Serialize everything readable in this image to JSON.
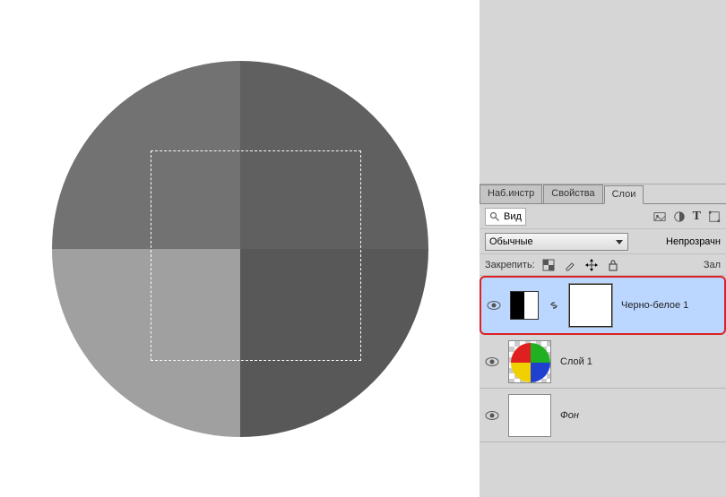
{
  "tabs": {
    "presets": "Наб.инстр",
    "properties": "Свойства",
    "layers": "Слои"
  },
  "search": {
    "label": "Вид"
  },
  "blend": {
    "mode": "Обычные",
    "opacity_label": "Непрозрачн"
  },
  "lock": {
    "label": "Закрепить:",
    "fill_label": "Зал"
  },
  "layers": {
    "adjust": {
      "name": "Черно-белое 1"
    },
    "layer1": {
      "name": "Слой 1"
    },
    "background": {
      "name": "Фон"
    }
  },
  "canvas": {
    "quadrants": {
      "tl": "#727272",
      "tr": "#606060",
      "bl": "#a0a0a0",
      "br": "#585858"
    }
  }
}
